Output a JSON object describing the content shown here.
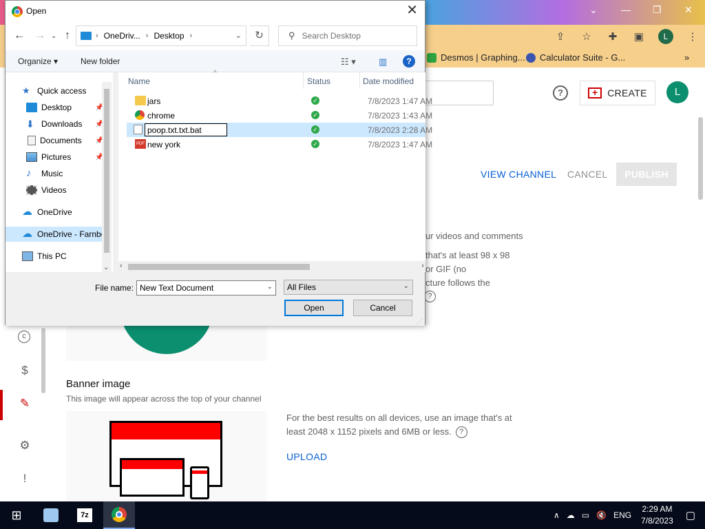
{
  "browser": {
    "bookmarks": [
      {
        "label": "Desmos | Graphing..."
      },
      {
        "label": "Calculator Suite - G..."
      }
    ],
    "overflow": "»"
  },
  "youtube": {
    "create_label": "CREATE",
    "avatar_letter": "L",
    "view_channel": "VIEW CHANNEL",
    "cancel": "CANCEL",
    "publish": "PUBLISH",
    "picture_text_1": "ur videos and comments",
    "picture_text_2": "that's at least 98 x 98",
    "picture_text_3": "or GIF (no",
    "picture_text_4": "cture follows the",
    "banner_title": "Banner image",
    "banner_desc": "This image will appear across the top of your channel",
    "banner_tip_1": "For the best results on all devices, use an image that's at",
    "banner_tip_2": "least 2048 x 1152 pixels and 6MB or less.",
    "upload": "UPLOAD"
  },
  "dialog": {
    "title": "Open",
    "breadcrumb": [
      "OneDriv...",
      "Desktop"
    ],
    "search_placeholder": "Search Desktop",
    "organize": "Organize",
    "new_folder": "New folder",
    "nav_items": [
      {
        "label": "Quick access",
        "icon": "star-icon"
      },
      {
        "label": "Desktop",
        "icon": "desktop-icon",
        "pinned": true
      },
      {
        "label": "Downloads",
        "icon": "downloads-icon",
        "pinned": true
      },
      {
        "label": "Documents",
        "icon": "documents-icon",
        "pinned": true
      },
      {
        "label": "Pictures",
        "icon": "pictures-icon",
        "pinned": true
      },
      {
        "label": "Music",
        "icon": "music-icon"
      },
      {
        "label": "Videos",
        "icon": "videos-icon"
      },
      {
        "label": "OneDrive",
        "icon": "cloud-icon"
      },
      {
        "label": "OneDrive - Farnbo",
        "icon": "cloud-icon",
        "selected": true
      },
      {
        "label": "This PC",
        "icon": "pc-icon"
      }
    ],
    "columns": {
      "name": "Name",
      "status": "Status",
      "date": "Date modified"
    },
    "files": [
      {
        "name": "jars",
        "type": "folder",
        "date": "7/8/2023 1:47 AM"
      },
      {
        "name": "chrome",
        "type": "chrome",
        "date": "7/8/2023 1:43 AM"
      },
      {
        "name": "",
        "type": "txt",
        "date": "7/8/2023 2:28 AM",
        "renaming": "poop.txt.txt.bat"
      },
      {
        "name": "new york",
        "type": "pdf",
        "date": "7/8/2023 1:47 AM"
      }
    ],
    "file_name_label": "File name:",
    "file_name_value": "New Text Document",
    "file_type": "All Files",
    "open_btn": "Open",
    "cancel_btn": "Cancel"
  },
  "taskbar": {
    "time": "2:29 AM",
    "date": "7/8/2023",
    "lang": "ENG"
  }
}
